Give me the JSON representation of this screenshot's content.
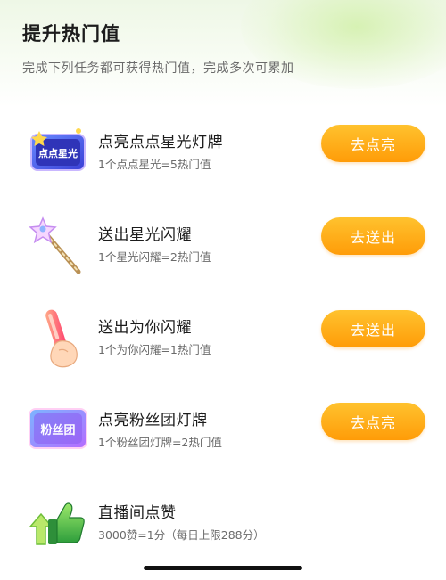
{
  "header": {
    "title": "提升热门值",
    "subtitle": "完成下列任务都可获得热门值，完成多次可累加"
  },
  "tasks": [
    {
      "name": "点亮点点星光灯牌",
      "desc": "1个点点星光=5热门值",
      "button": "去点亮",
      "icon_text": "点点星光",
      "icon": "star-light-sign-icon"
    },
    {
      "name": "送出星光闪耀",
      "desc": "1个星光闪耀=2热门值",
      "button": "去送出",
      "icon": "star-wand-icon"
    },
    {
      "name": "送出为你闪耀",
      "desc": "1个为你闪耀=1热门值",
      "button": "去送出",
      "icon": "glow-stick-icon"
    },
    {
      "name": "点亮粉丝团灯牌",
      "desc": "1个粉丝团灯牌=2热门值",
      "button": "去点亮",
      "icon_text": "粉丝团",
      "icon": "fan-club-sign-icon"
    },
    {
      "name": "直播间点赞",
      "desc": "3000赞=1分（每日上限288分）",
      "icon": "thumbs-up-icon"
    }
  ],
  "colors": {
    "button": "#ffa414",
    "title": "#1c1c1c",
    "subtext": "#6b6b6b"
  }
}
